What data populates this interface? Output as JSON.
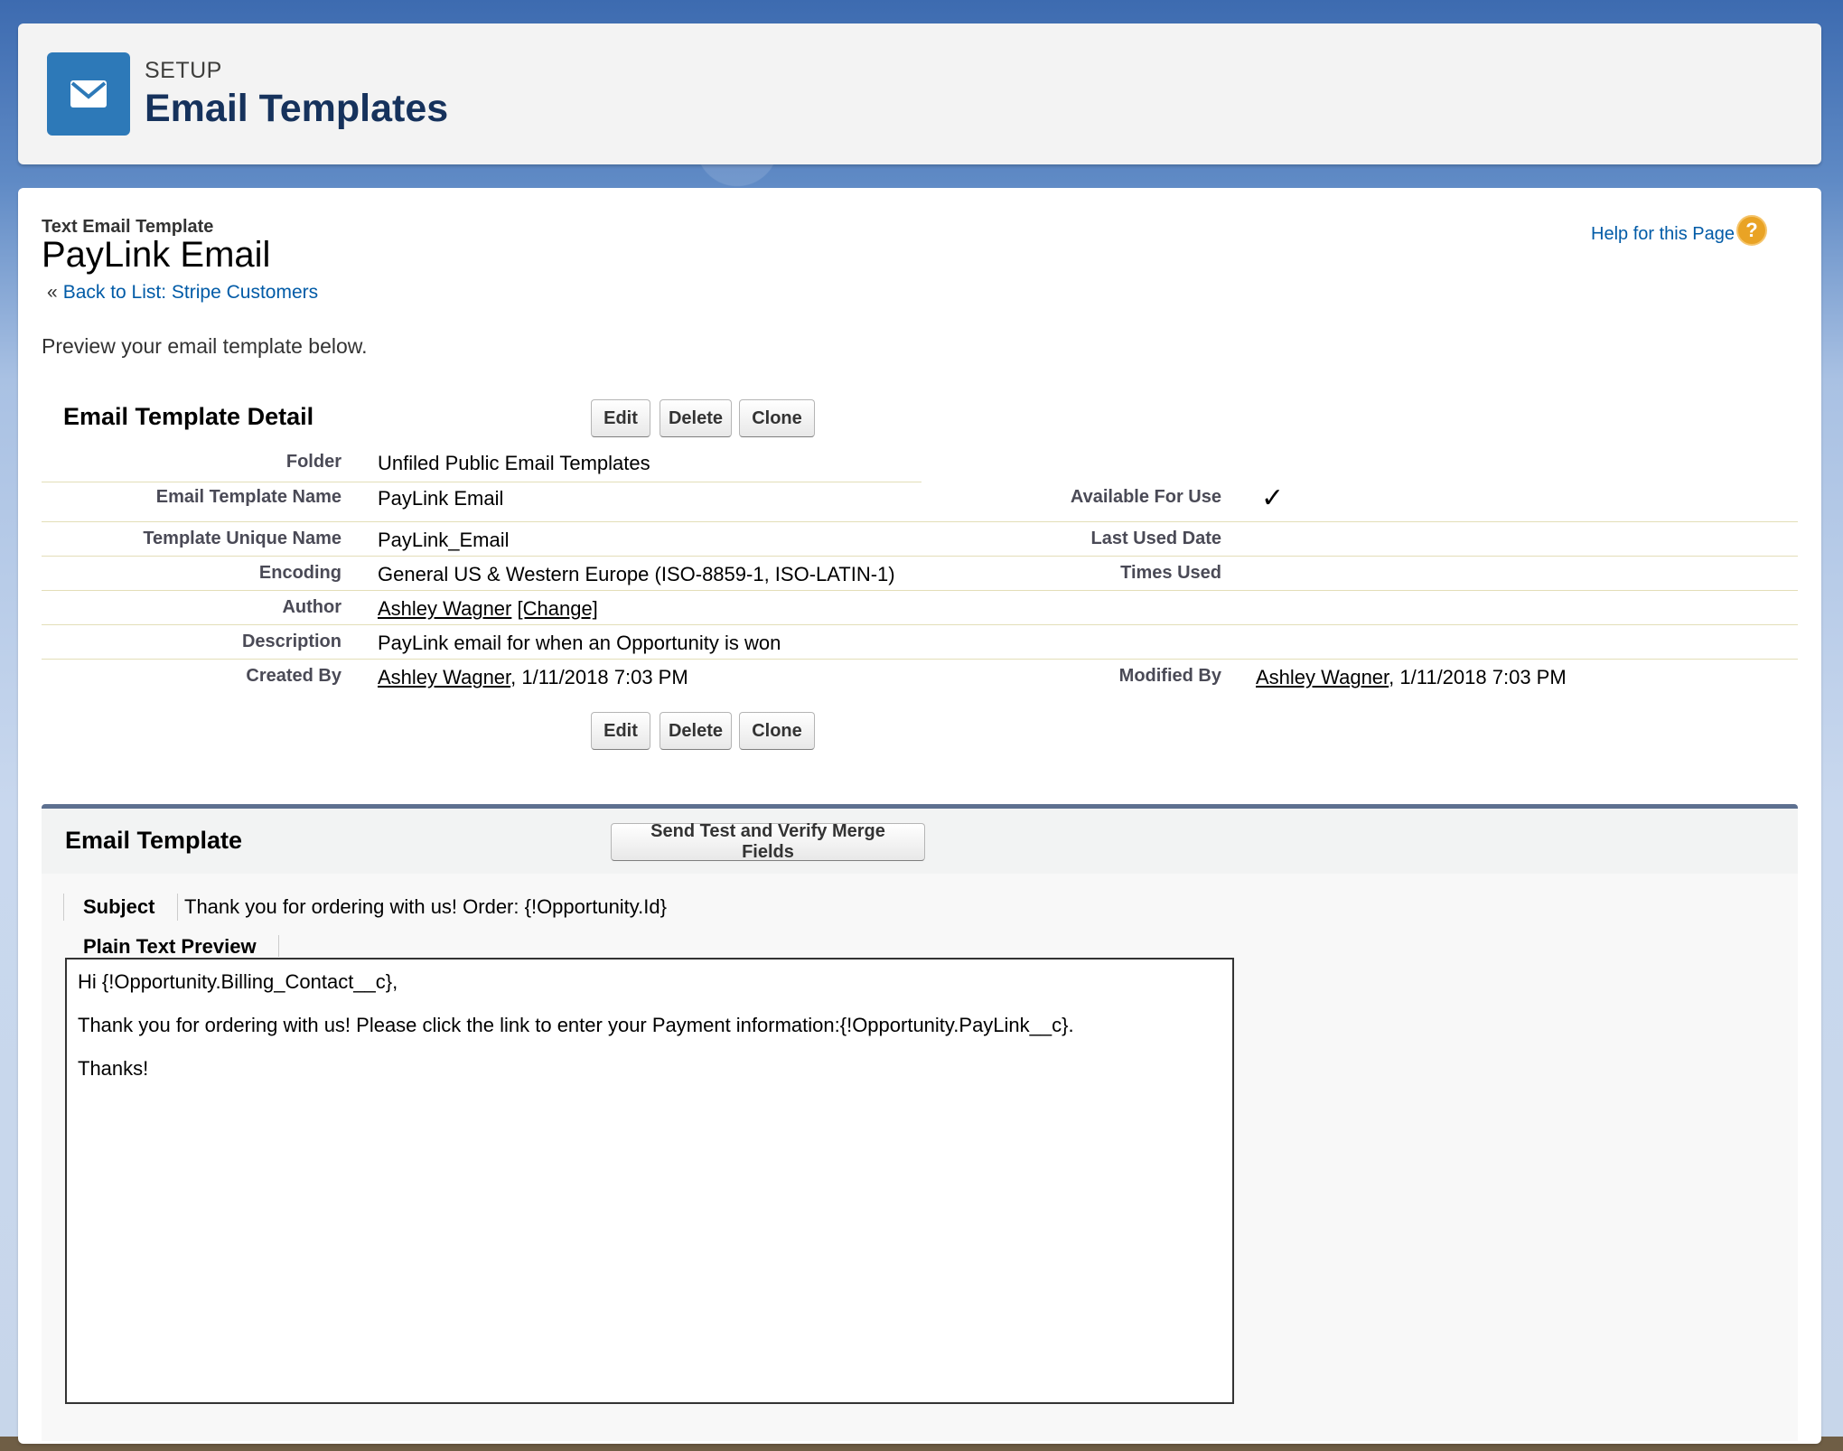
{
  "header": {
    "eyebrow": "SETUP",
    "title": "Email Templates",
    "icon": "envelope-icon"
  },
  "page": {
    "subtitle": "Text Email Template",
    "title": "PayLink Email",
    "back_link": "Back to List: Stripe Customers",
    "back_prefix": "«",
    "help_link": "Help for this Page",
    "help_icon": "?",
    "intro": "Preview your email template below."
  },
  "detail": {
    "title": "Email Template Detail",
    "buttons": {
      "edit": "Edit",
      "delete": "Delete",
      "clone": "Clone"
    },
    "folder_label": "Folder",
    "folder_value": "Unfiled Public Email Templates",
    "name_label": "Email Template Name",
    "name_value": "PayLink Email",
    "available_label": "Available For Use",
    "available_value": "✓",
    "unique_label": "Template Unique Name",
    "unique_value": "PayLink_Email",
    "last_used_label": "Last Used Date",
    "last_used_value": "",
    "encoding_label": "Encoding",
    "encoding_value": "General US & Western Europe (ISO-8859-1, ISO-LATIN-1)",
    "times_used_label": "Times Used",
    "times_used_value": "",
    "author_label": "Author",
    "author_name": "Ashley Wagner",
    "author_change": "[Change]",
    "description_label": "Description",
    "description_value": "PayLink email for when an Opportunity is won",
    "created_label": "Created By",
    "created_name": "Ashley Wagner",
    "created_date": ", 1/11/2018 7:03 PM",
    "modified_label": "Modified By",
    "modified_name": "Ashley Wagner",
    "modified_date": ", 1/11/2018 7:03 PM"
  },
  "email_template": {
    "title": "Email Template",
    "send_test_button": "Send Test and Verify Merge Fields",
    "subject_label": "Subject",
    "subject_value": "Thank you for ordering with us! Order: {!Opportunity.Id}",
    "preview_label": "Plain Text Preview",
    "preview_lines": [
      "Hi {!Opportunity.Billing_Contact__c},",
      "Thank you for ordering with us! Please click the link to enter your Payment information:{!Opportunity.PayLink__c}.",
      "Thanks!"
    ]
  }
}
